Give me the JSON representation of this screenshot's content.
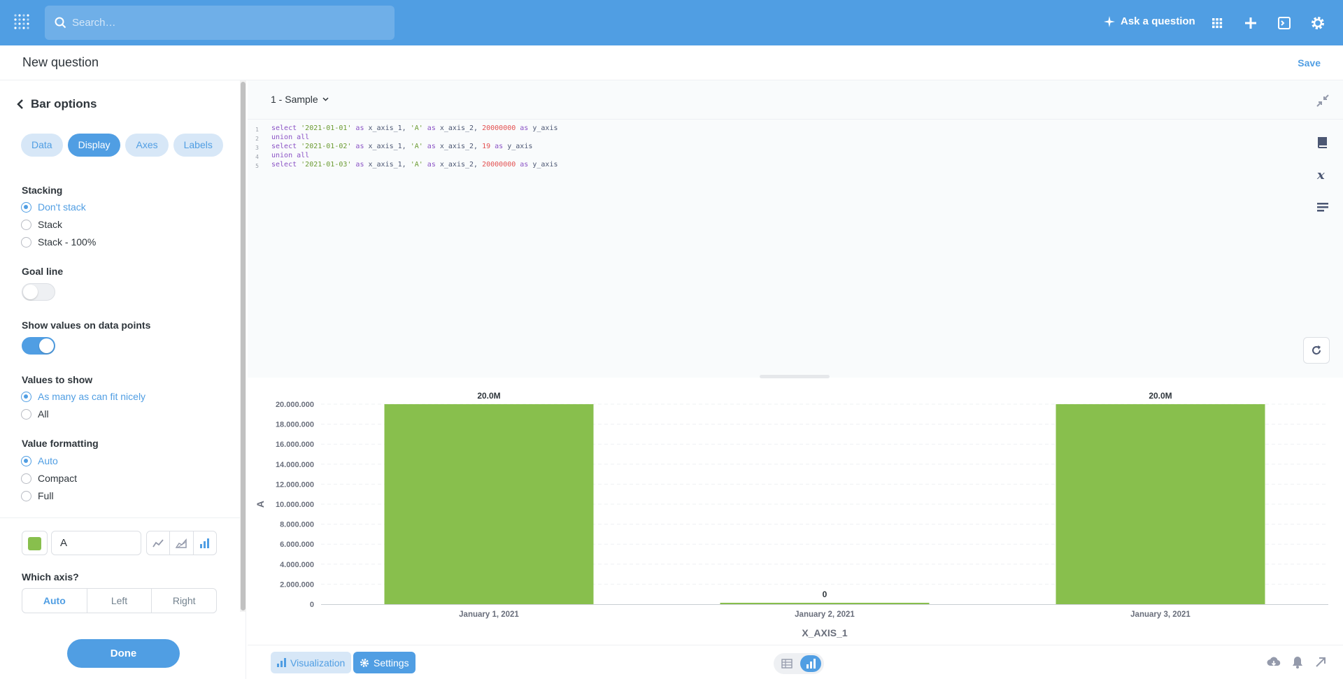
{
  "nav": {
    "search_placeholder": "Search…",
    "ask_label": "Ask a question"
  },
  "header": {
    "title": "New question",
    "save_label": "Save"
  },
  "sidebar": {
    "back_label": "Bar options",
    "tabs": [
      {
        "label": "Data",
        "active": false
      },
      {
        "label": "Display",
        "active": true
      },
      {
        "label": "Axes",
        "active": false
      },
      {
        "label": "Labels",
        "active": false
      }
    ],
    "stacking": {
      "label": "Stacking",
      "options": [
        "Don't stack",
        "Stack",
        "Stack - 100%"
      ],
      "selected": "Don't stack"
    },
    "goal_line": {
      "label": "Goal line",
      "on": false
    },
    "show_values": {
      "label": "Show values on data points",
      "on": true
    },
    "values_to_show": {
      "label": "Values to show",
      "options": [
        "As many as can fit nicely",
        "All"
      ],
      "selected": "As many as can fit nicely"
    },
    "value_formatting": {
      "label": "Value formatting",
      "options": [
        "Auto",
        "Compact",
        "Full"
      ],
      "selected": "Auto"
    },
    "series": {
      "name": "A",
      "color": "#88BF4D"
    },
    "which_axis": {
      "label": "Which axis?",
      "options": [
        "Auto",
        "Left",
        "Right"
      ],
      "selected": "Auto"
    },
    "done_label": "Done"
  },
  "editor": {
    "database": "1 - Sample",
    "lines": [
      {
        "n": "1",
        "parts": [
          [
            "kw",
            "select "
          ],
          [
            "str",
            "'2021-01-01'"
          ],
          [
            "kw",
            " as "
          ],
          [
            "",
            "x_axis_1, "
          ],
          [
            "str",
            "'A'"
          ],
          [
            "kw",
            " as "
          ],
          [
            "",
            "x_axis_2, "
          ],
          [
            "num",
            "20000000"
          ],
          [
            "kw",
            " as "
          ],
          [
            "",
            "y_axis"
          ]
        ]
      },
      {
        "n": "2",
        "parts": [
          [
            "kw",
            "union all"
          ]
        ]
      },
      {
        "n": "3",
        "parts": [
          [
            "kw",
            "select "
          ],
          [
            "str",
            "'2021-01-02'"
          ],
          [
            "kw",
            " as "
          ],
          [
            "",
            "x_axis_1, "
          ],
          [
            "str",
            "'A'"
          ],
          [
            "kw",
            " as "
          ],
          [
            "",
            "x_axis_2, "
          ],
          [
            "num",
            "19"
          ],
          [
            "kw",
            " as "
          ],
          [
            "",
            "y_axis"
          ]
        ]
      },
      {
        "n": "4",
        "parts": [
          [
            "kw",
            "union all"
          ]
        ]
      },
      {
        "n": "5",
        "parts": [
          [
            "kw",
            "select "
          ],
          [
            "str",
            "'2021-01-03'"
          ],
          [
            "kw",
            " as "
          ],
          [
            "",
            "x_axis_1, "
          ],
          [
            "str",
            "'A'"
          ],
          [
            "kw",
            " as "
          ],
          [
            "",
            "x_axis_2, "
          ],
          [
            "num",
            "20000000"
          ],
          [
            "kw",
            " as "
          ],
          [
            "",
            "y_axis"
          ]
        ]
      }
    ]
  },
  "chart_data": {
    "type": "bar",
    "categories": [
      "January 1, 2021",
      "January 2, 2021",
      "January 3, 2021"
    ],
    "series": [
      {
        "name": "A",
        "values": [
          20000000,
          19,
          20000000
        ],
        "color": "#88BF4D"
      }
    ],
    "data_labels": [
      "20.0M",
      "0",
      "20.0M"
    ],
    "xlabel": "X_AXIS_1",
    "ylabel": "A",
    "ylim": [
      0,
      20000000
    ],
    "yticks": [
      "0",
      "2.000.000",
      "4.000.000",
      "6.000.000",
      "8.000.000",
      "10.000.000",
      "12.000.000",
      "14.000.000",
      "16.000.000",
      "18.000.000",
      "20.000.000"
    ],
    "grid": true
  },
  "footer": {
    "visualization_label": "Visualization",
    "settings_label": "Settings"
  }
}
